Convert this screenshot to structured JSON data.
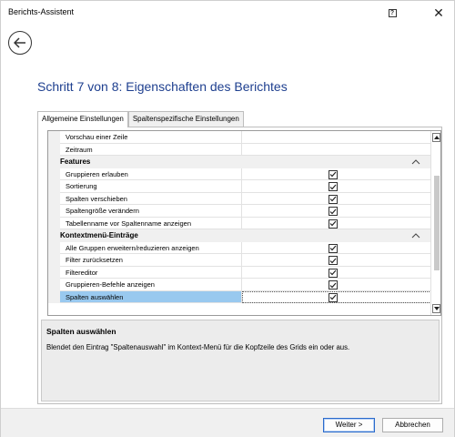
{
  "window": {
    "title": "Berichts-Assistent",
    "help_icon": "help-icon",
    "close_label": "✕"
  },
  "heading": "Schritt 7 von 8: Eigenschaften des Berichtes",
  "tabs": [
    {
      "label": "Allgemeine Einstellungen",
      "active": true
    },
    {
      "label": "Spaltenspezifische Einstellungen",
      "active": false
    }
  ],
  "grid": {
    "rows": [
      {
        "kind": "prop",
        "name": "Vorschau einer Zeile",
        "checked": null
      },
      {
        "kind": "prop",
        "name": "Zeitraum",
        "checked": null
      },
      {
        "kind": "cat",
        "name": "Features",
        "expanded": true
      },
      {
        "kind": "prop",
        "name": "Gruppieren erlauben",
        "checked": true
      },
      {
        "kind": "prop",
        "name": "Sortierung",
        "checked": true
      },
      {
        "kind": "prop",
        "name": "Spalten verschieben",
        "checked": true
      },
      {
        "kind": "prop",
        "name": "Spaltengröße verändern",
        "checked": true
      },
      {
        "kind": "prop",
        "name": "Tabellenname vor Spaltenname anzeigen",
        "checked": true
      },
      {
        "kind": "cat",
        "name": "Kontextmenü-Einträge",
        "expanded": true
      },
      {
        "kind": "prop",
        "name": "Alle Gruppen erweitern/reduzieren anzeigen",
        "checked": true
      },
      {
        "kind": "prop",
        "name": "Filter zurücksetzen",
        "checked": true
      },
      {
        "kind": "prop",
        "name": "Filtereditor",
        "checked": true
      },
      {
        "kind": "prop",
        "name": "Gruppieren-Befehle anzeigen",
        "checked": true
      },
      {
        "kind": "prop",
        "name": "Spalten auswählen",
        "checked": true,
        "selected": true
      }
    ],
    "scroll_position": 0.5,
    "scroll_visible_fraction": 0.6
  },
  "description": {
    "title": "Spalten auswählen",
    "text": "Blendet den Eintrag \"Spaltenauswahl\" im Kontext-Menü für die Kopfzeile des Grids ein oder aus."
  },
  "buttons": {
    "next": "Weiter >",
    "cancel": "Abbrechen"
  },
  "colors": {
    "heading": "#1e3f8f",
    "selected_row": "#99c9ef",
    "default_button_border": "#2a6acb"
  }
}
